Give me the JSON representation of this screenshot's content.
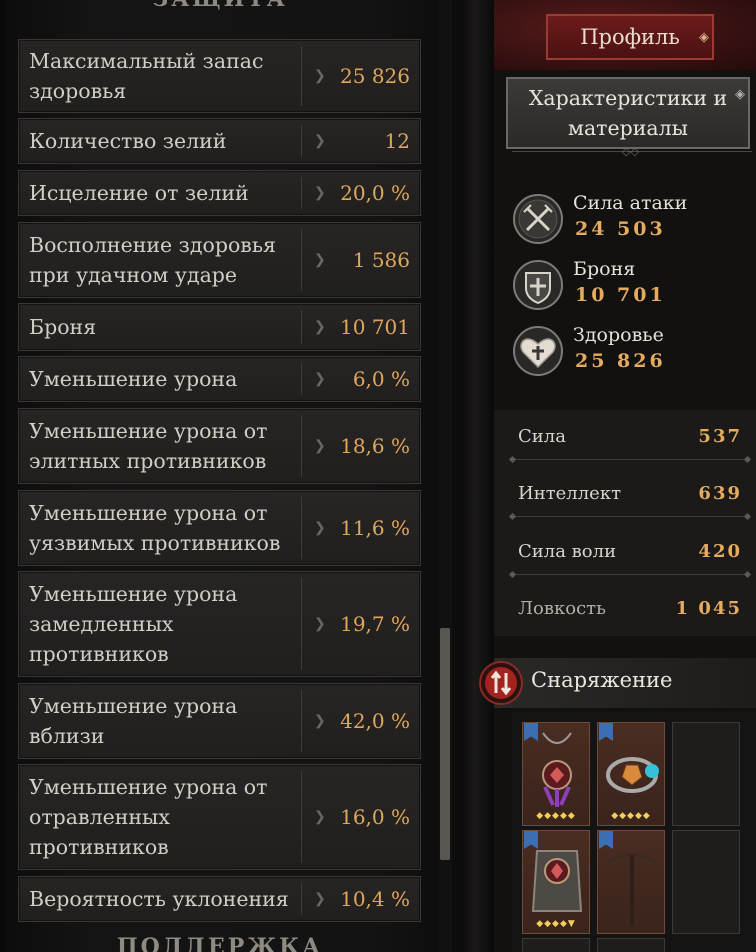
{
  "defense_panel": {
    "section_title_top": "ЗАЩИТА",
    "section_title_bottom": "ПОДДЕРЖКА",
    "rows": [
      {
        "label": "Максимальный запас здоровья",
        "value": "25 826"
      },
      {
        "label": "Количество зелий",
        "value": "12"
      },
      {
        "label": "Исцеление от зелий",
        "value": "20,0 %"
      },
      {
        "label": "Восполнение здоровья при удачном ударе",
        "value": "1 586"
      },
      {
        "label": "Броня",
        "value": "10 701"
      },
      {
        "label": "Уменьшение урона",
        "value": "6,0 %"
      },
      {
        "label": "Уменьшение урона от элитных противников",
        "value": "18,6 %"
      },
      {
        "label": "Уменьшение урона от уязвимых противников",
        "value": "11,6 %"
      },
      {
        "label": "Уменьшение урона замедленных противников",
        "value": "19,7 %"
      },
      {
        "label": "Уменьшение урона вблизи",
        "value": "42,0 %"
      },
      {
        "label": "Уменьшение урона от отравленных противников",
        "value": "16,0 %"
      },
      {
        "label": "Вероятность уклонения",
        "value": "10,4 %"
      }
    ]
  },
  "right_panel": {
    "profile_button": "Профиль",
    "characteristics_button": "Характеристики и материалы",
    "main_stats": [
      {
        "name": "Сила атаки",
        "value": "24 503",
        "icon": "crossed-swords-icon"
      },
      {
        "name": "Броня",
        "value": "10 701",
        "icon": "shield-icon"
      },
      {
        "name": "Здоровье",
        "value": "25 826",
        "icon": "heart-icon"
      }
    ],
    "attributes": [
      {
        "name": "Сила",
        "value": "537"
      },
      {
        "name": "Интеллект",
        "value": "639"
      },
      {
        "name": "Сила воли",
        "value": "420"
      },
      {
        "name": "Ловкость",
        "value": "1 045"
      }
    ],
    "gear_title": "Снаряжение",
    "gear_toggle_icon": "swap-arrows-icon"
  },
  "colors": {
    "value_gold": "#e0a75a",
    "profile_red": "#6d1b1b",
    "text_light": "#d2cdc5"
  }
}
